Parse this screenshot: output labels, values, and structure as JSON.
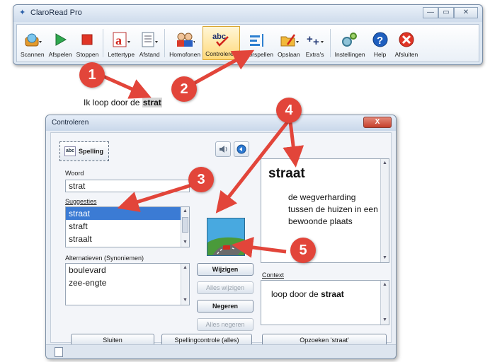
{
  "app": {
    "title": "ClaroRead Pro",
    "window_buttons": [
      "—",
      "▭",
      "✕"
    ],
    "toolbar": [
      {
        "label": "Scannen",
        "icon": "scanner-icon"
      },
      {
        "label": "Afspelen",
        "icon": "play-icon"
      },
      {
        "label": "Stoppen",
        "icon": "stop-icon"
      },
      {
        "label": "Lettertype",
        "icon": "font-icon"
      },
      {
        "label": "Afstand",
        "icon": "spacing-icon"
      },
      {
        "label": "Homofonen",
        "icon": "homophones-icon"
      },
      {
        "label": "Controleren",
        "icon": "spellcheck-icon"
      },
      {
        "label": "Voorspellen",
        "icon": "predict-icon"
      },
      {
        "label": "Opslaan",
        "icon": "save-icon"
      },
      {
        "label": "Extra's",
        "icon": "extras-icon"
      },
      {
        "label": "Instellingen",
        "icon": "settings-icon"
      },
      {
        "label": "Help",
        "icon": "help-icon"
      },
      {
        "label": "Afsluiten",
        "icon": "exit-icon"
      }
    ]
  },
  "document": {
    "sentence_prefix": "Ik loop door de ",
    "sentence_word": "strat"
  },
  "callouts": [
    "1",
    "2",
    "3",
    "4",
    "5"
  ],
  "dialog": {
    "title": "Controleren",
    "close_label": "X",
    "spelling_tab": "Spelling",
    "woord_label": "Woord",
    "woord_value": "strat",
    "suggesties_label": "Suggesties",
    "suggesties": [
      "straat",
      "straft",
      "straalt"
    ],
    "alternatieven_label": "Alternatieven (Synoniemen)",
    "alternatieven": [
      "boulevard",
      "zee-engte"
    ],
    "buttons": {
      "wijzigen": "Wijzigen",
      "alles_wijzigen": "Alles wijzigen",
      "negeren": "Negeren",
      "alles_negeren": "Alles negeren",
      "sluiten": "Sluiten",
      "spellingcontrole": "Spellingcontrole (alles)",
      "opzoeken": "Opzoeken 'straat'"
    },
    "definition_word": "straat",
    "definition_text": "de wegverharding tussen de huizen in een bewoonde plaats",
    "context_label": "Context",
    "context_prefix": "loop door de ",
    "context_word": "straat"
  },
  "colors": {
    "callout": "#e2453a",
    "selection": "#3b7bd4"
  }
}
